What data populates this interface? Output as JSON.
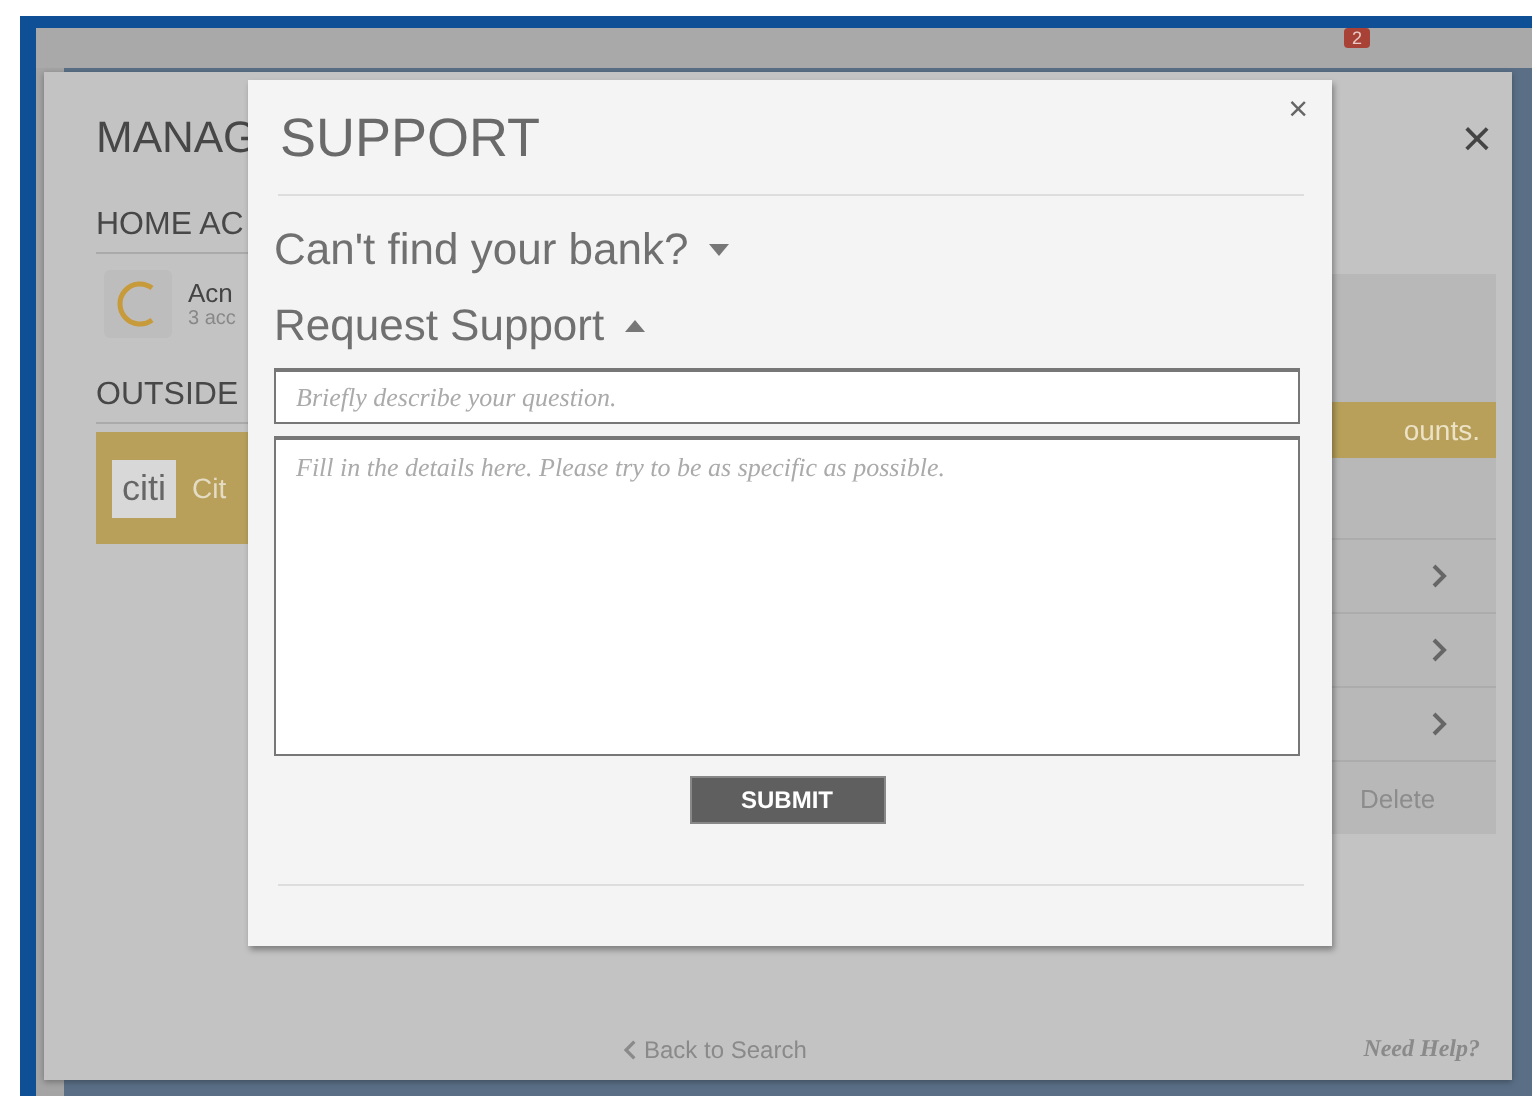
{
  "toolbar": {
    "badge": "2"
  },
  "manage_dialog": {
    "title": "MANAG",
    "close": "×",
    "home_heading": "HOME AC",
    "home_account": {
      "name": "Acn",
      "detail": "3 acc"
    },
    "outside_heading": "OUTSIDE",
    "outside_account": {
      "logo": "citi",
      "name": "Cit",
      "selected": true
    },
    "banner": "ounts.",
    "delete": "Delete",
    "back_link": "Back to Search",
    "help_link": "Need Help?"
  },
  "support_dialog": {
    "title": "SUPPORT",
    "close": "×",
    "sections": [
      {
        "label": "Can't find your bank?",
        "expanded": false
      },
      {
        "label": "Request Support",
        "expanded": true
      }
    ],
    "subject": {
      "placeholder": "Briefly describe your question."
    },
    "details": {
      "placeholder": "Fill in the details here. Please try to be as specific as possible."
    },
    "submit": "SUBMIT"
  }
}
